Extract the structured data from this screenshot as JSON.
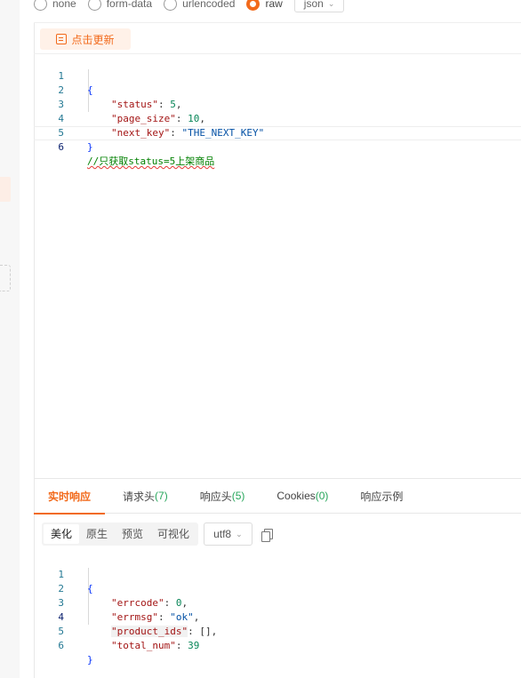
{
  "body_types": [
    {
      "label": "none",
      "selected": false
    },
    {
      "label": "form-data",
      "selected": false
    },
    {
      "label": "urlencoded",
      "selected": false
    },
    {
      "label": "raw",
      "selected": true
    }
  ],
  "raw_format": {
    "value": "json",
    "icon": "chevron-down-icon"
  },
  "refresh_button": {
    "label": "点击更新",
    "icon": "refresh-doc-icon"
  },
  "request_editor": {
    "line_numbers": [
      "1",
      "2",
      "3",
      "4",
      "5",
      "6"
    ],
    "open_brace": "{",
    "close_brace": "}",
    "fields": [
      {
        "key": "\"status\"",
        "colon": ": ",
        "value": "5",
        "comma": ","
      },
      {
        "key": "\"page_size\"",
        "colon": ": ",
        "value": "10",
        "comma": ","
      },
      {
        "key": "\"next_key\"",
        "colon": ": ",
        "value": "\"THE_NEXT_KEY\"",
        "comma": ""
      }
    ],
    "comment": "//只获取status=5上架商品"
  },
  "response_tabs": [
    {
      "label": "实时响应",
      "count": "",
      "active": true
    },
    {
      "label": "请求头",
      "count": "(7)",
      "active": false
    },
    {
      "label": "响应头",
      "count": "(5)",
      "active": false
    },
    {
      "label": "Cookies",
      "count": "(0)",
      "active": false
    },
    {
      "label": "响应示例",
      "count": "",
      "active": false
    }
  ],
  "view_modes": [
    {
      "label": "美化",
      "selected": true
    },
    {
      "label": "原生",
      "selected": false
    },
    {
      "label": "预览",
      "selected": false
    },
    {
      "label": "可视化",
      "selected": false
    }
  ],
  "encoding": {
    "value": "utf8",
    "icon": "chevron-down-icon"
  },
  "copy": {
    "icon": "copy-icon"
  },
  "response_editor": {
    "line_numbers": [
      "1",
      "2",
      "3",
      "4",
      "5",
      "6"
    ],
    "open_brace": "{",
    "close_brace": "}",
    "fields": [
      {
        "key": "\"errcode\"",
        "colon": ": ",
        "value": "0",
        "comma": ","
      },
      {
        "key": "\"errmsg\"",
        "colon": ": ",
        "value": "\"ok\"",
        "comma": ","
      },
      {
        "key": "\"product_ids\"",
        "colon": ": ",
        "value": "[]",
        "comma": ","
      },
      {
        "key": "\"total_num\"",
        "colon": ": ",
        "value": "39",
        "comma": ""
      }
    ]
  },
  "colors": {
    "accent": "#f26a1b",
    "count_green": "#26a65b",
    "comment_green": "#008000"
  }
}
